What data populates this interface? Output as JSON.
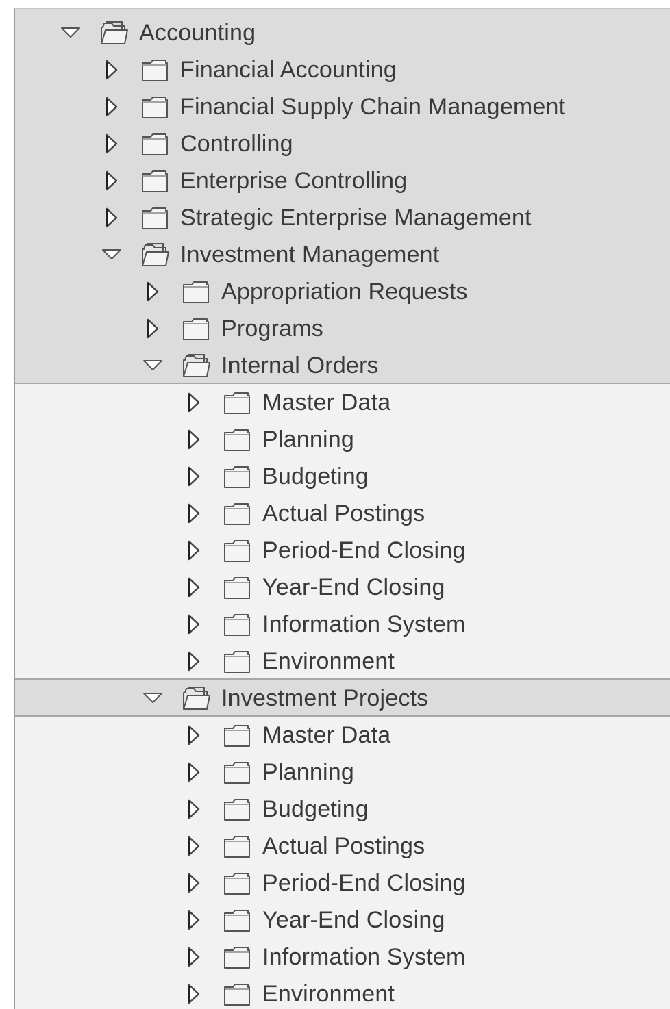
{
  "tree": {
    "nodes": [
      {
        "label": "Accounting",
        "level": 0,
        "expanded": true,
        "shade": "dark"
      },
      {
        "label": "Financial Accounting",
        "level": 1,
        "expanded": false,
        "shade": "dark"
      },
      {
        "label": "Financial Supply Chain Management",
        "level": 1,
        "expanded": false,
        "shade": "dark"
      },
      {
        "label": "Controlling",
        "level": 1,
        "expanded": false,
        "shade": "dark"
      },
      {
        "label": "Enterprise Controlling",
        "level": 1,
        "expanded": false,
        "shade": "dark"
      },
      {
        "label": "Strategic Enterprise Management",
        "level": 1,
        "expanded": false,
        "shade": "dark"
      },
      {
        "label": "Investment Management",
        "level": 1,
        "expanded": true,
        "shade": "dark"
      },
      {
        "label": "Appropriation Requests",
        "level": 2,
        "expanded": false,
        "shade": "dark"
      },
      {
        "label": "Programs",
        "level": 2,
        "expanded": false,
        "shade": "dark"
      },
      {
        "label": "Internal Orders",
        "level": 2,
        "expanded": true,
        "shade": "dark"
      },
      {
        "label": "Master Data",
        "level": 3,
        "expanded": false,
        "shade": "light"
      },
      {
        "label": "Planning",
        "level": 3,
        "expanded": false,
        "shade": "light"
      },
      {
        "label": "Budgeting",
        "level": 3,
        "expanded": false,
        "shade": "light"
      },
      {
        "label": "Actual Postings",
        "level": 3,
        "expanded": false,
        "shade": "light"
      },
      {
        "label": "Period-End Closing",
        "level": 3,
        "expanded": false,
        "shade": "light"
      },
      {
        "label": "Year-End Closing",
        "level": 3,
        "expanded": false,
        "shade": "light"
      },
      {
        "label": "Information System",
        "level": 3,
        "expanded": false,
        "shade": "light"
      },
      {
        "label": "Environment",
        "level": 3,
        "expanded": false,
        "shade": "light"
      },
      {
        "label": "Investment Projects",
        "level": 2,
        "expanded": true,
        "shade": "dark"
      },
      {
        "label": "Master Data",
        "level": 3,
        "expanded": false,
        "shade": "light"
      },
      {
        "label": "Planning",
        "level": 3,
        "expanded": false,
        "shade": "light"
      },
      {
        "label": "Budgeting",
        "level": 3,
        "expanded": false,
        "shade": "light"
      },
      {
        "label": "Actual Postings",
        "level": 3,
        "expanded": false,
        "shade": "light"
      },
      {
        "label": "Period-End Closing",
        "level": 3,
        "expanded": false,
        "shade": "light"
      },
      {
        "label": "Year-End Closing",
        "level": 3,
        "expanded": false,
        "shade": "light"
      },
      {
        "label": "Information System",
        "level": 3,
        "expanded": false,
        "shade": "light"
      },
      {
        "label": "Environment",
        "level": 3,
        "expanded": false,
        "shade": "light"
      }
    ]
  },
  "colors": {
    "row_dark": "#dcdcdc",
    "row_light": "#f2f2f2",
    "text": "#3a3a3a",
    "icon_stroke": "#555555",
    "folder_fill": "#f4f4f4"
  }
}
